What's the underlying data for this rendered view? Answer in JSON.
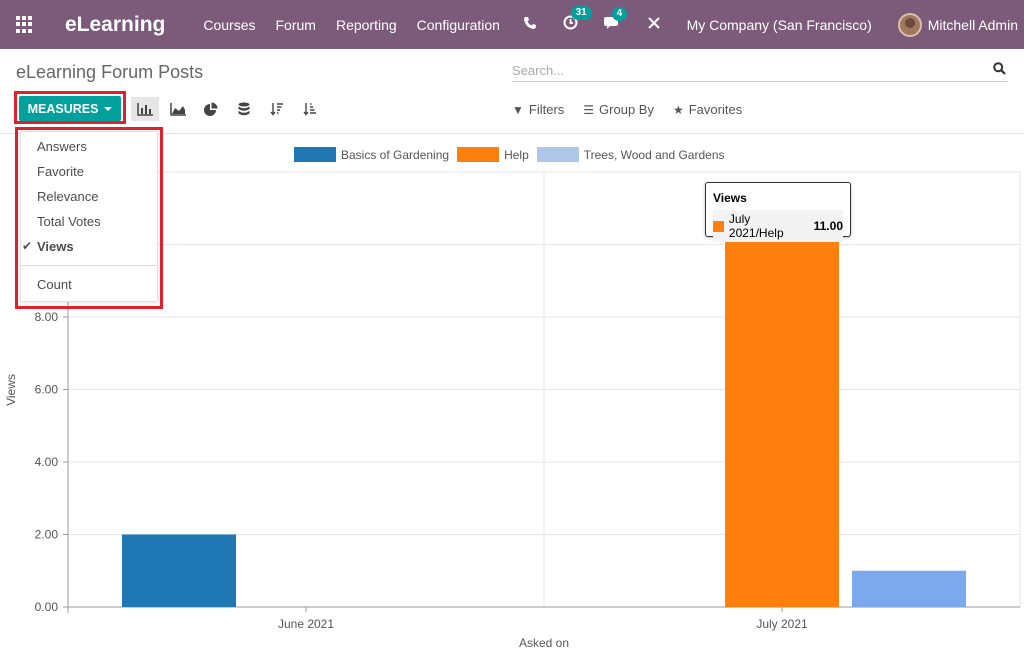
{
  "navbar": {
    "brand": "eLearning",
    "menu": [
      "Courses",
      "Forum",
      "Reporting",
      "Configuration"
    ],
    "activity_count": "31",
    "message_count": "4",
    "company": "My Company (San Francisco)",
    "user": "Mitchell Admin"
  },
  "control_panel": {
    "title": "eLearning Forum Posts",
    "search_placeholder": "Search...",
    "measures_label": "MEASURES",
    "filters_label": "Filters",
    "groupby_label": "Group By",
    "favorites_label": "Favorites",
    "active_view": "bar"
  },
  "measures_menu": {
    "items": [
      {
        "label": "Answers",
        "checked": false
      },
      {
        "label": "Favorite",
        "checked": false
      },
      {
        "label": "Relevance",
        "checked": false
      },
      {
        "label": "Total Votes",
        "checked": false
      },
      {
        "label": "Views",
        "checked": true
      }
    ],
    "count_label": "Count"
  },
  "tooltip": {
    "title": "Views",
    "label": "July 2021/Help",
    "value": "11.00"
  },
  "colors": {
    "navbar": "#7c5a7a",
    "accent": "#00a09d",
    "highlight_box": "#e0202a"
  },
  "chart_data": {
    "type": "bar",
    "categories": [
      "June 2021",
      "July 2021"
    ],
    "series": [
      {
        "name": "Basics of Gardening",
        "color": "#1f77b4",
        "values": [
          2,
          0
        ]
      },
      {
        "name": "Help",
        "color": "#ff7f0e",
        "values": [
          0,
          11
        ]
      },
      {
        "name": "Trees, Wood and Gardens",
        "color": "#aec7e8",
        "values": [
          0,
          1
        ]
      }
    ],
    "xlabel": "Asked on",
    "ylabel": "Views",
    "ylim": [
      0,
      12
    ],
    "yticks": [
      "0.00",
      "2.00",
      "4.00",
      "6.00",
      "8.00"
    ],
    "legend_position": "top",
    "grid": true
  }
}
